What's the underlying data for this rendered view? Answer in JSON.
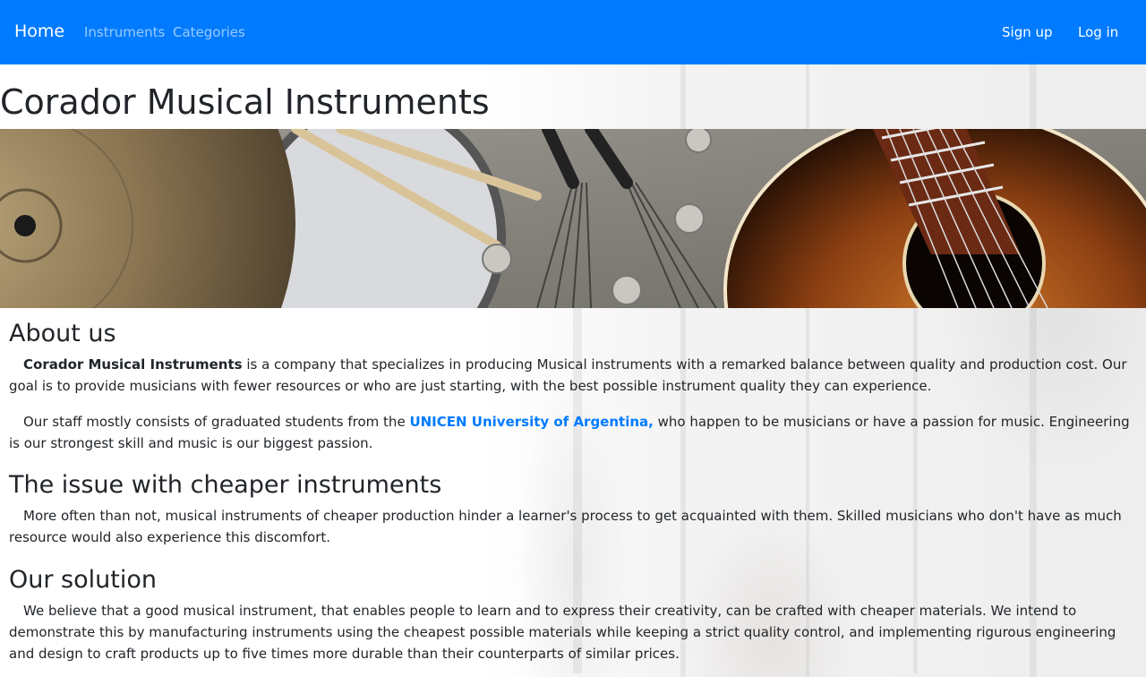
{
  "nav": {
    "brand": "Home",
    "links": [
      "Instruments",
      "Categories"
    ],
    "right_links": [
      "Sign up",
      "Log in"
    ]
  },
  "page_title": "Corador Musical Instruments",
  "about": {
    "heading": "About us",
    "p1_strong": "Corador Musical Instruments",
    "p1_rest": " is a company that specializes in producing Musical instruments with a remarked balance between quality and production cost. Our goal is to provide musicians with fewer resources or who are just starting, with the best possible instrument quality they can experience.",
    "p2_before": "Our staff mostly consists of graduated students from the ",
    "p2_link": "UNICEN University of Argentina,",
    "p2_after": " who happen to be musicians or have a passion for music. Engineering is our strongest skill and music is our biggest passion."
  },
  "issue": {
    "heading": "The issue with cheaper instruments",
    "p1": "More often than not, musical instruments of cheaper production hinder a learner's process to get acquainted with them. Skilled musicians who don't have as much resource would also experience this discomfort."
  },
  "solution": {
    "heading": "Our solution",
    "p1": "We believe that a good musical instrument, that enables people to learn and to express their creativity, can be crafted with cheaper materials. We intend to demonstrate this by manufacturing instruments using the cheapest possible materials while keeping a strict quality control, and implementing rigurous engineering and design to craft products up to five times more durable than their counterparts of similar prices."
  },
  "colors": {
    "navbar": "#007bff",
    "link": "#007bff",
    "text": "#212529"
  }
}
